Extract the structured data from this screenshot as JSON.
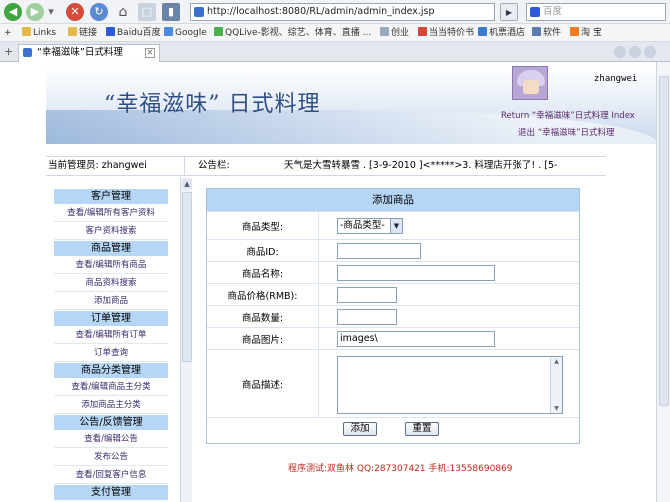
{
  "browser": {
    "url": "http://localhost:8080/RL/admin/admin_index.jsp",
    "search_placeholder": "百度",
    "tab_title": "“幸福滋味”日式料理",
    "bookmarks": [
      "Links",
      "链接",
      "Baidu百度",
      "Google",
      "QQLive-影视、综艺、体育、直播 ...",
      "创业",
      "当当特价书",
      "机票酒店",
      "软件",
      "淘 宝"
    ]
  },
  "header": {
    "banner_title": "“幸福滋味” 日式料理",
    "username": "zhangwei",
    "return_link": "Return “幸福滋味”日式料理 Index",
    "logout_link": "退出 “幸福滋味”日式料理"
  },
  "infobar": {
    "admin_label": "当前管理员: zhangwei",
    "notice_label": "公告栏:",
    "notice_text": "天气是大雪转暴雪 . [3-9-2010 ]<*****>3. 料理店开张了! . [5-"
  },
  "sidebar": {
    "sections": [
      {
        "title": "客户管理",
        "items": [
          "查看/编辑所有客户资料",
          "客户资料搜索"
        ]
      },
      {
        "title": "商品管理",
        "items": [
          "查看/编辑所有商品",
          "商品资料搜索",
          "添加商品"
        ]
      },
      {
        "title": "订单管理",
        "items": [
          "查看/编辑所有订单",
          "订单查询"
        ]
      },
      {
        "title": "商品分类管理",
        "items": [
          "查看/编辑商品主分类",
          "添加商品主分类"
        ]
      },
      {
        "title": "公告/反馈管理",
        "items": [
          "查看/编辑公告",
          "发布公告",
          "查看/回复客户信息"
        ]
      },
      {
        "title": "支付管理",
        "items": []
      }
    ]
  },
  "form": {
    "title": "添加商品",
    "category_label": "商品类型:",
    "category_value": "-商品类型-",
    "id_label": "商品ID:",
    "name_label": "商品名称:",
    "price_label": "商品价格(RMB):",
    "qty_label": "商品数量:",
    "image_label": "商品图片:",
    "image_value": "images\\",
    "desc_label": "商品描述:",
    "add_button": "添加",
    "reset_button": "重置"
  },
  "footer": {
    "text": "程序测试:双鱼林 QQ:287307421 手机:13558690869"
  },
  "colors": {
    "header_blue": "#b5d6f5",
    "banner_text": "#2f4f86",
    "footer_red": "#c0281d",
    "link_purple": "#5a2a6a"
  }
}
